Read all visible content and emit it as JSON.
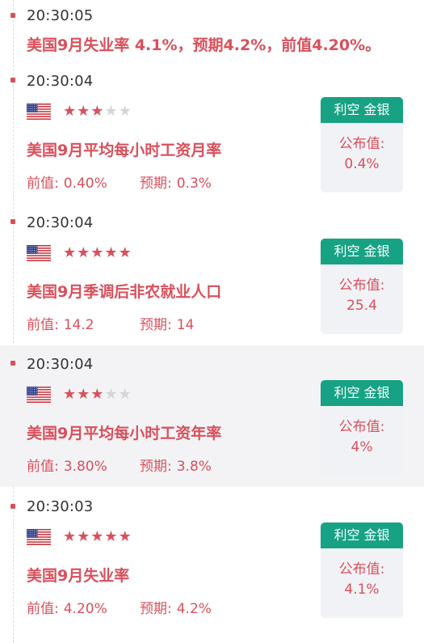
{
  "colors": {
    "accent": "#d8505c",
    "tag_bg": "#17a284",
    "card_bg": "#f1f2f6",
    "star_off": "#d3d5da",
    "highlight_bg": "#f3f3f5"
  },
  "items": [
    {
      "time": "20:30:05",
      "headline": "美国9月失业率 4.1%，预期4.2%，前值4.20%。"
    },
    {
      "time": "20:30:04",
      "flag_icon": "us-flag-icon",
      "importance": 3,
      "title": "美国9月平均每小时工资月率",
      "previous_label": "前值:",
      "previous": "0.40%",
      "forecast_label": "预期:",
      "forecast": "0.3%",
      "tag": "利空 金银",
      "actual_label": "公布值:",
      "actual": "0.4%"
    },
    {
      "time": "20:30:04",
      "flag_icon": "us-flag-icon",
      "importance": 5,
      "title": "美国9月季调后非农就业人口",
      "previous_label": "前值:",
      "previous": "14.2",
      "forecast_label": "预期:",
      "forecast": "14",
      "tag": "利空 金银",
      "actual_label": "公布值:",
      "actual": "25.4"
    },
    {
      "time": "20:30:04",
      "flag_icon": "us-flag-icon",
      "importance": 3,
      "title": "美国9月平均每小时工资年率",
      "previous_label": "前值:",
      "previous": "3.80%",
      "forecast_label": "预期:",
      "forecast": "3.8%",
      "tag": "利空 金银",
      "actual_label": "公布值:",
      "actual": "4%"
    },
    {
      "time": "20:30:03",
      "flag_icon": "us-flag-icon",
      "importance": 5,
      "title": "美国9月失业率",
      "previous_label": "前值:",
      "previous": "4.20%",
      "forecast_label": "预期:",
      "forecast": "4.2%",
      "tag": "利空 金银",
      "actual_label": "公布值:",
      "actual": "4.1%"
    }
  ]
}
